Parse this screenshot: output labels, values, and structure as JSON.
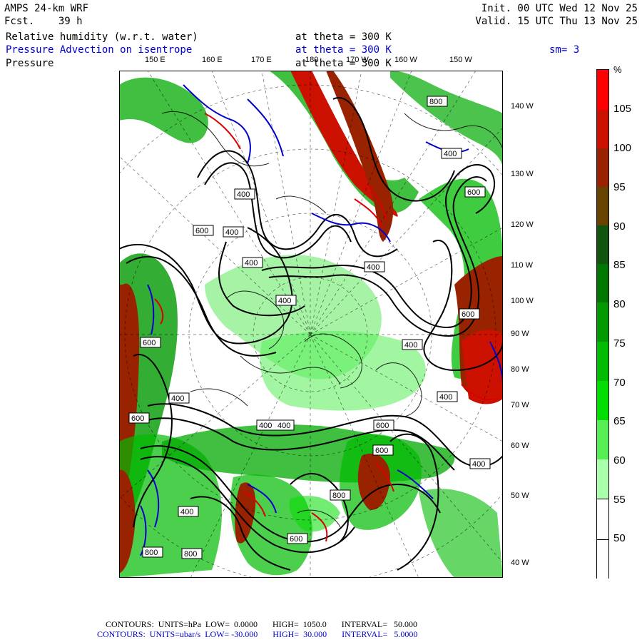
{
  "header": {
    "model": "AMPS 24-km WRF",
    "fcst_label": "Fcst.",
    "fcst_hours": "39 h",
    "init": "Init. 00 UTC Wed 12 Nov 25",
    "valid": "Valid. 15 UTC Thu 13 Nov 25"
  },
  "fields": {
    "rh_label": "Relative humidity (w.r.t. water)",
    "rh_level": "at theta = 300 K",
    "adv_label": "Pressure Advection on isentrope",
    "adv_level": "at theta = 300 K",
    "smooth": "sm= 3",
    "pres_label": "Pressure",
    "pres_level": "at theta = 300 K"
  },
  "longitude_labels_top": [
    "150 E",
    "160 E",
    "170 E",
    "180",
    "170 W",
    "160 W",
    "150 W"
  ],
  "longitude_labels_right": [
    "140 W",
    "130 W",
    "120 W",
    "110 W",
    "100 W",
    "90 W",
    "80 W",
    "70 W",
    "60 W",
    "50 W",
    "40 W"
  ],
  "contour_labels": [
    "800",
    "400",
    "600",
    "400",
    "400",
    "400",
    "400",
    "600",
    "400",
    "600",
    "600",
    "400",
    "400",
    "400",
    "400",
    "600",
    "600",
    "600",
    "400",
    "800",
    "400",
    "600",
    "800",
    "800",
    "600",
    "400"
  ],
  "colorbar": {
    "unit": "%",
    "levels": [
      "105",
      "100",
      "95",
      "90",
      "85",
      "80",
      "75",
      "70",
      "65",
      "60",
      "55",
      "50"
    ],
    "colors": [
      "#ff0000",
      "#cc1100",
      "#992200",
      "#664400",
      "#115511",
      "#007700",
      "#009900",
      "#00bb00",
      "#00dd00",
      "#55ee55",
      "#aaffaa",
      "#ffffff",
      "#ffffff"
    ]
  },
  "footer": {
    "line1": "CONTOURS:  UNITS=hPa  LOW=  0.0000       HIGH=  1050.0       INTERVAL=   50.000",
    "line2": "CONTOURS:  UNITS=ubar/s  LOW= -30.000       HIGH=  30.000       INTERVAL=   5.0000"
  },
  "colors": {
    "pressure_contour": "#000000",
    "adv_positive": "#0000cc",
    "adv_negative": "#dd0000"
  }
}
